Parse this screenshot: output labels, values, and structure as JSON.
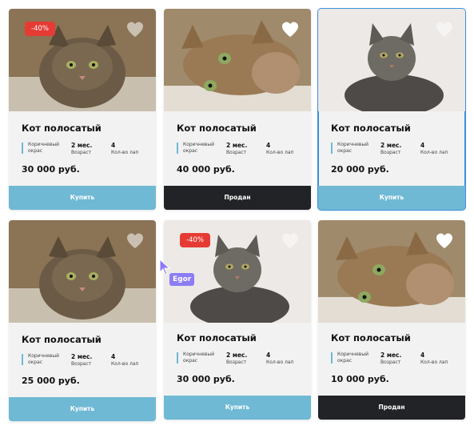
{
  "cards": [
    {
      "title": "Кот полосатый",
      "discount": "-40%",
      "color": "Коричневый окрас",
      "age": "2 мес.",
      "age_label": "Возраст",
      "paws": "4",
      "paws_label": "Кол-во лап",
      "price": "30 000 руб.",
      "button": "Купить",
      "status": "available",
      "liked": false
    },
    {
      "title": "Кот полосатый",
      "discount": "",
      "color": "Коричневый окрас",
      "age": "2 мес.",
      "age_label": "Возраст",
      "paws": "4",
      "paws_label": "Кол-во лап",
      "price": "40 000 руб.",
      "button": "Продан",
      "status": "sold",
      "liked": true
    },
    {
      "title": "Кот полосатый",
      "discount": "",
      "color": "Коричневый окрас",
      "age": "2 мес.",
      "age_label": "Возраст",
      "paws": "4",
      "paws_label": "Кол-во лап",
      "price": "20 000 руб.",
      "button": "Купить",
      "status": "available",
      "liked": false
    },
    {
      "title": "Кот полосатый",
      "discount": "",
      "color": "Коричневый окрас",
      "age": "2 мес.",
      "age_label": "Возраст",
      "paws": "4",
      "paws_label": "Кол-во лап",
      "price": "25 000 руб.",
      "button": "Купить",
      "status": "available",
      "liked": false
    },
    {
      "title": "Кот полосатый",
      "discount": "-40%",
      "color": "Коричневый окрас",
      "age": "2 мес.",
      "age_label": "Возраст",
      "paws": "4",
      "paws_label": "Кол-во лап",
      "price": "30 000 руб.",
      "button": "Купить",
      "status": "available",
      "liked": false
    },
    {
      "title": "Кот полосатый",
      "discount": "",
      "color": "Коричневый окрас",
      "age": "2 мес.",
      "age_label": "Возраст",
      "paws": "4",
      "paws_label": "Кол-во лап",
      "price": "10 000 руб.",
      "button": "Продан",
      "status": "sold",
      "liked": true
    }
  ],
  "cursor": {
    "user": "Egor",
    "color": "#8c7cf5"
  },
  "colors": {
    "accent": "#6fb9d4",
    "sold": "#222326",
    "discount": "#e63b34",
    "selection": "#3d8fe0"
  }
}
